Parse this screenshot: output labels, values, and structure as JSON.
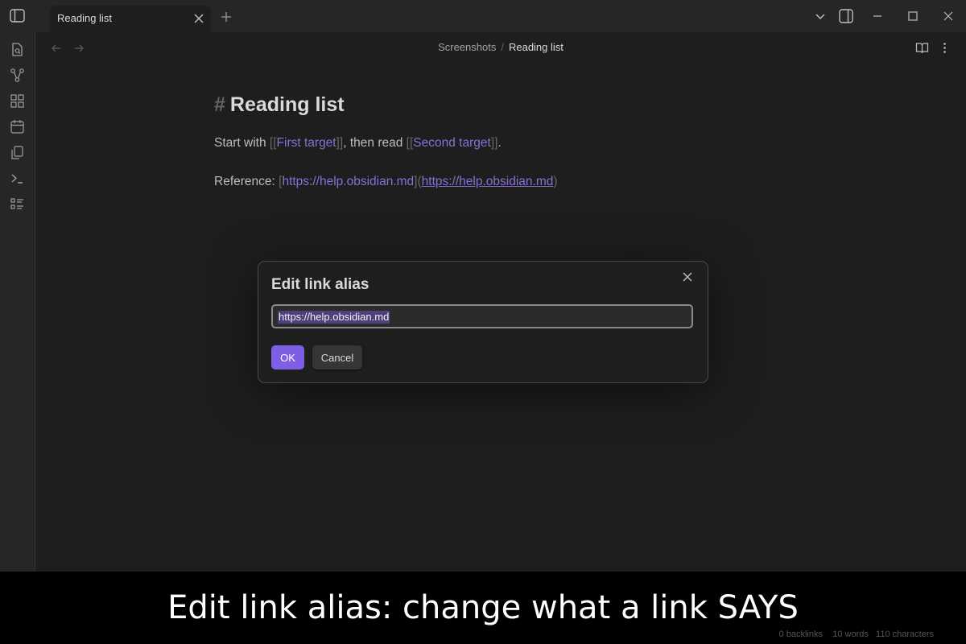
{
  "tab": {
    "title": "Reading list"
  },
  "breadcrumb": {
    "folder": "Screenshots",
    "separator": "/",
    "current": "Reading list"
  },
  "note": {
    "heading_marker": "#",
    "heading": "Reading list",
    "line1": {
      "prefix": "Start with ",
      "link1_open": "[[",
      "link1": "First target",
      "link1_close": "]]",
      "middle": ", then read ",
      "link2_open": "[[",
      "link2": "Second target",
      "link2_close": "]]",
      "suffix": "."
    },
    "line2": {
      "prefix": "Reference: ",
      "alias_open": "[",
      "alias": "https://help.obsidian.md",
      "alias_close": "]",
      "url_open": "(",
      "url": "https://help.obsidian.md",
      "url_close": ")"
    }
  },
  "modal": {
    "title": "Edit link alias",
    "input_value": "https://help.obsidian.md",
    "ok_label": "OK",
    "cancel_label": "Cancel"
  },
  "statusbar": {
    "backlinks": "0 backlinks",
    "words": "10 words",
    "characters": "110 characters"
  },
  "caption": "Edit link alias: change what a link SAYS",
  "colors": {
    "accent": "#7f5ee6",
    "link": "#8a6fd6",
    "background": "#1e1e1e",
    "chrome": "#262626"
  }
}
